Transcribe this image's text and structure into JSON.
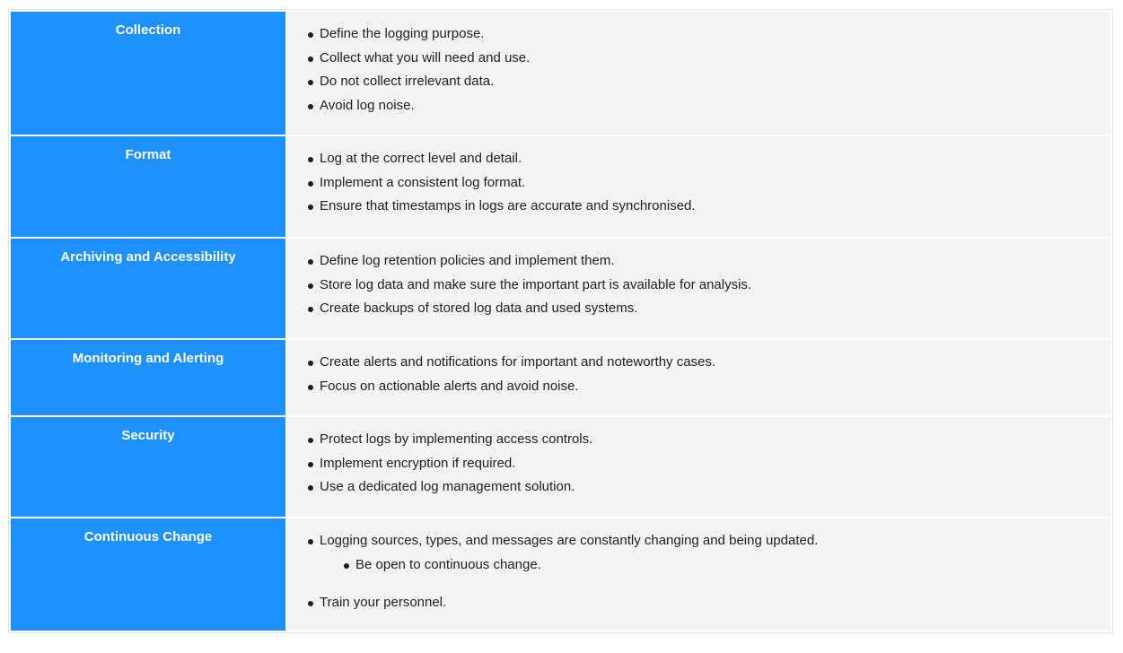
{
  "rows": [
    {
      "heading": "Collection",
      "items": [
        {
          "text": "Define the logging purpose."
        },
        {
          "text": "Collect what you will need and use."
        },
        {
          "text": "Do not collect irrelevant data."
        },
        {
          "text": "Avoid log noise."
        }
      ]
    },
    {
      "heading": "Format",
      "items": [
        {
          "text": "Log at the correct level and detail."
        },
        {
          "text": "Implement a consistent log format."
        },
        {
          "text": "Ensure that timestamps in logs are accurate and synchronised."
        }
      ]
    },
    {
      "heading": "Archiving and Accessibility",
      "items": [
        {
          "text": "Define log retention policies and implement them."
        },
        {
          "text": "Store log data and make sure the important part is available for analysis."
        },
        {
          "text": "Create backups of stored log data and used systems."
        }
      ]
    },
    {
      "heading": "Monitoring and Alerting",
      "items": [
        {
          "text": "Create alerts and notifications for important and noteworthy cases."
        },
        {
          "text": "Focus on actionable alerts and avoid noise."
        }
      ]
    },
    {
      "heading": "Security",
      "items": [
        {
          "text": "Protect logs by implementing access controls."
        },
        {
          "text": "Implement encryption if required."
        },
        {
          "text": "Use a dedicated log management solution."
        }
      ]
    },
    {
      "heading": "Continuous Change",
      "items": [
        {
          "text": "Logging sources, types, and messages are constantly changing and being updated.",
          "subitems": [
            {
              "text": "Be open to continuous change."
            }
          ]
        },
        {
          "text": "Train your personnel."
        }
      ]
    }
  ],
  "colors": {
    "heading_bg": "#1e90ff",
    "heading_text": "#ffffff",
    "body_bg": "#f4f4f4"
  }
}
